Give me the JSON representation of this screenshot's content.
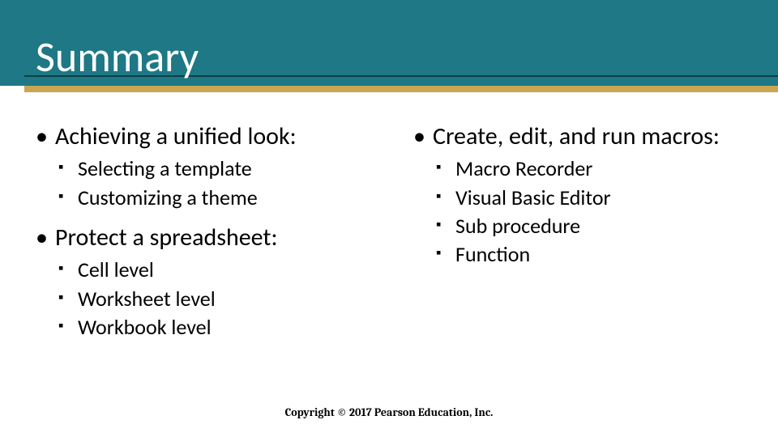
{
  "title": "Summary",
  "columns": {
    "left": [
      {
        "heading": "Achieving a unified look:",
        "items": [
          "Selecting a template",
          "Customizing a theme"
        ]
      },
      {
        "heading": "Protect a spreadsheet:",
        "items": [
          "Cell level",
          "Worksheet level",
          "Workbook level"
        ]
      }
    ],
    "right": [
      {
        "heading": "Create, edit, and run macros:",
        "items": [
          "Macro Recorder",
          "Visual Basic Editor",
          "Sub procedure",
          "Function"
        ]
      }
    ]
  },
  "footer": "Copyright © 2017 Pearson Education, Inc."
}
